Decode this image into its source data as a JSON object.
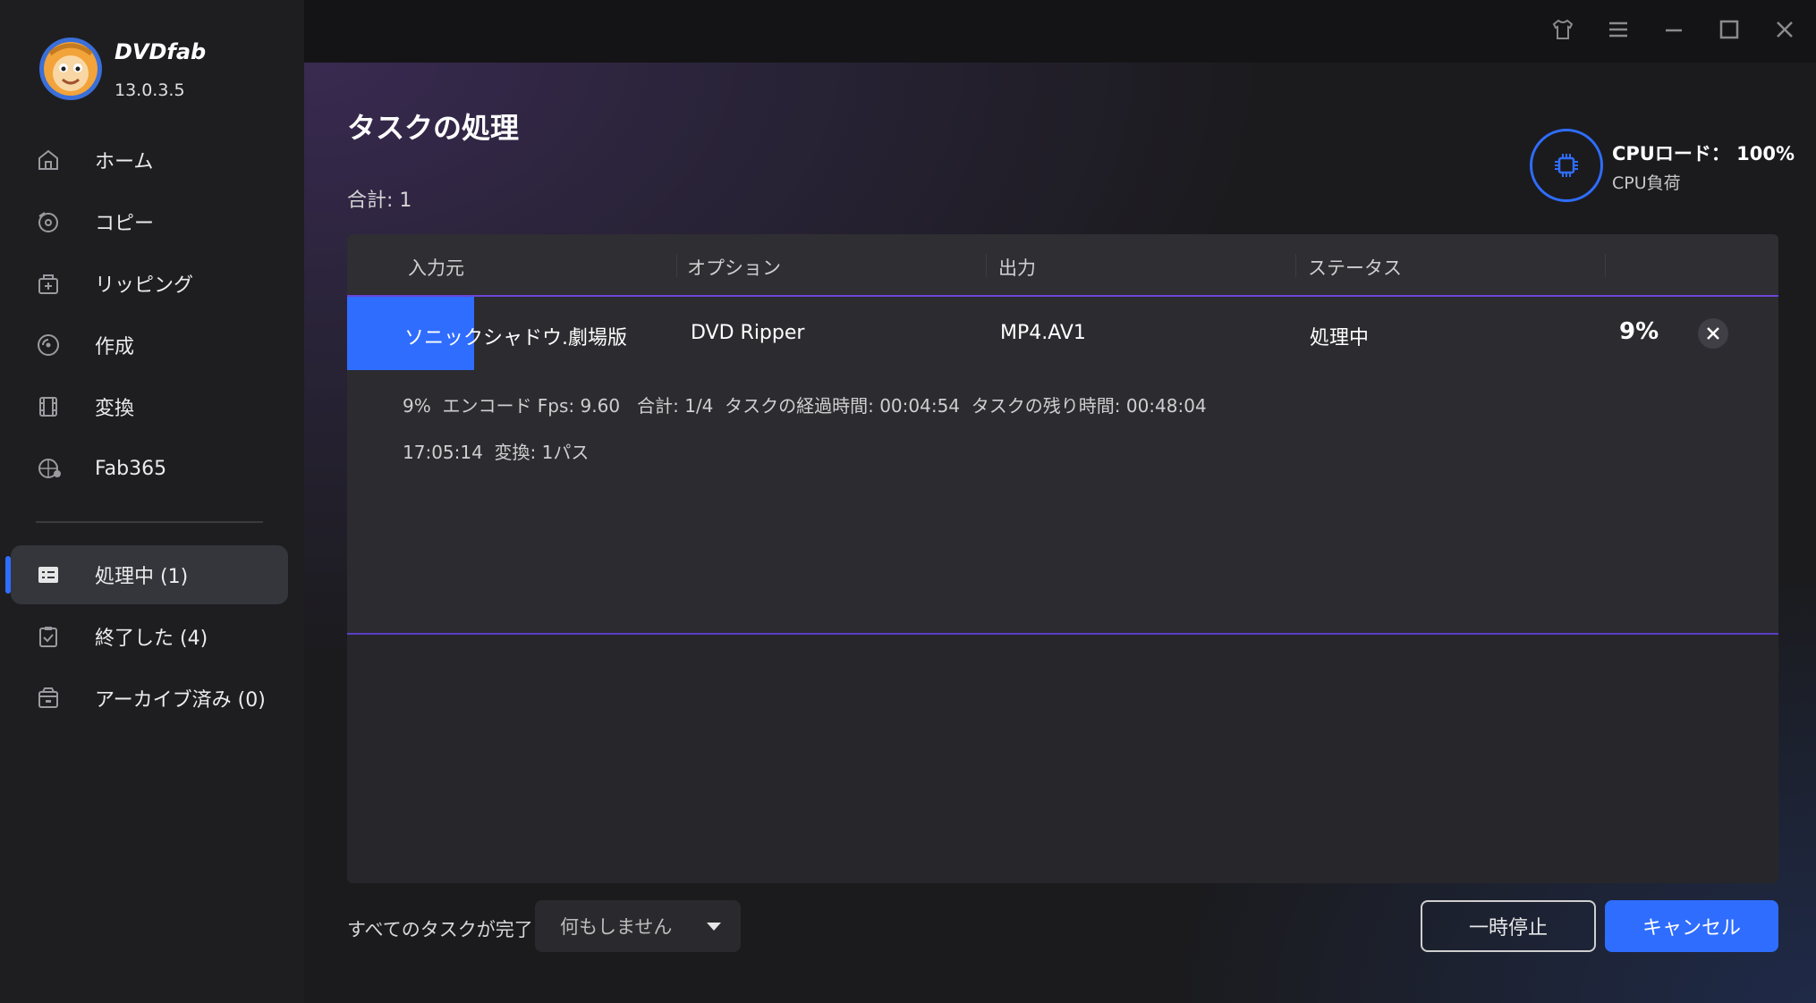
{
  "app": {
    "brand": "DVDfab",
    "version": "13.0.3.5"
  },
  "sidebar": {
    "items": [
      {
        "label": "ホーム",
        "icon": "home-icon"
      },
      {
        "label": "コピー",
        "icon": "copy-disc-icon"
      },
      {
        "label": "リッピング",
        "icon": "ripper-icon"
      },
      {
        "label": "作成",
        "icon": "creator-disc-icon"
      },
      {
        "label": "変換",
        "icon": "film-icon"
      },
      {
        "label": "Fab365",
        "icon": "fab365-icon"
      }
    ],
    "task_items": [
      {
        "label": "処理中 (1)",
        "icon": "task-list-icon",
        "active": true
      },
      {
        "label": "終了した (4)",
        "icon": "clipboard-check-icon",
        "active": false
      },
      {
        "label": "アーカイブ済み (0)",
        "icon": "archive-box-icon",
        "active": false
      }
    ]
  },
  "header": {
    "title": "タスクの処理",
    "total": "合計: 1",
    "cpu_load": "CPUロード： 100%",
    "cpu_label": "CPU負荷"
  },
  "table": {
    "columns": [
      "入力元",
      "オプション",
      "出力",
      "ステータス"
    ],
    "row": {
      "source": "ソニックシャドウ.劇場版",
      "option": "DVD Ripper",
      "output": "MP4.AV1",
      "status": "処理中",
      "percent": "9%",
      "progress": 0.09
    },
    "details": [
      "9%  エンコード Fps: 9.60   合計: 1/4  タスクの経過時間: 00:04:54  タスクの残り時間: 00:48:04",
      "17:05:14  変換: 1パス"
    ]
  },
  "footer": {
    "all_done_label": "すべてのタスクが完了:",
    "all_done_value": "何もしません",
    "pause_label": "一時停止",
    "cancel_label": "キャンセル"
  },
  "colors": {
    "accent": "#2f6dff",
    "highlight": "#6d45d8"
  }
}
